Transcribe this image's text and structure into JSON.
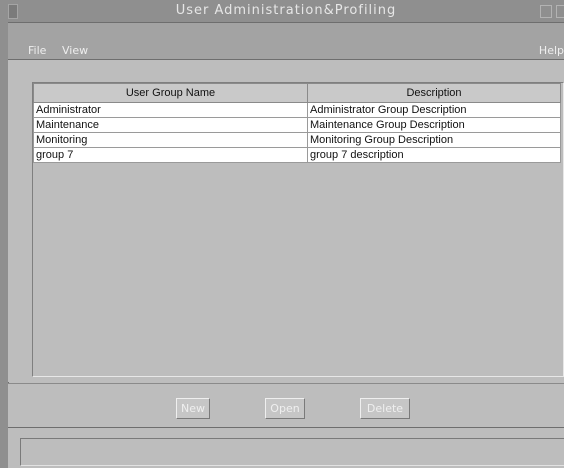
{
  "window": {
    "title": "User Administration&Profiling"
  },
  "menu": {
    "file": "File",
    "view": "View",
    "help": "Help"
  },
  "table": {
    "headers": [
      "User Group Name",
      "Description"
    ],
    "rows": [
      {
        "name": "Administrator",
        "description": "Administrator Group Description"
      },
      {
        "name": "Maintenance",
        "description": "Maintenance Group Description"
      },
      {
        "name": "Monitoring",
        "description": "Monitoring Group Description"
      },
      {
        "name": "group 7",
        "description": "group 7 description"
      }
    ]
  },
  "buttons": {
    "new": "New",
    "open": "Open",
    "delete": "Delete"
  },
  "status": {
    "text": ""
  }
}
